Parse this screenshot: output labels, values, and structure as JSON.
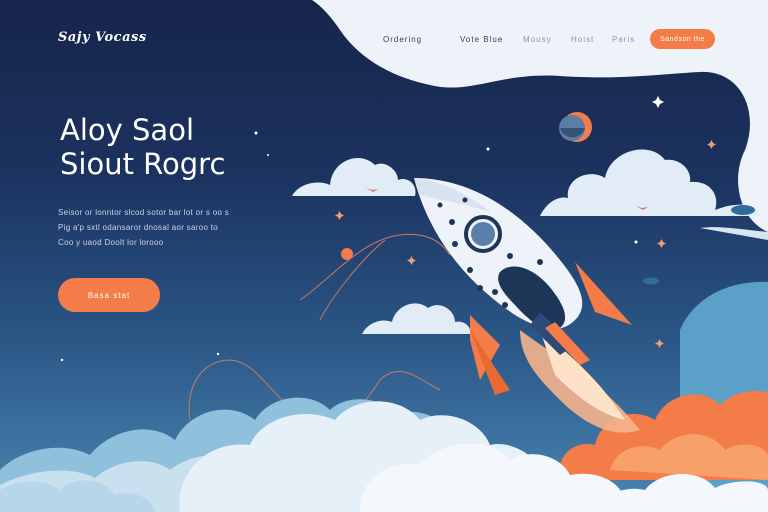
{
  "header": {
    "logo_text": "Sajy Vocass",
    "nav": [
      "Ordering",
      "Vote Blue",
      "Mousy",
      "Hoist",
      "Paris"
    ],
    "cta_label": "Sandson the"
  },
  "hero": {
    "title_lines": [
      "Aloy Saol",
      "Siout Rogrc"
    ],
    "body_lines": [
      "Seisor or lonntor slcod sotor bar lot or s oo s",
      "Pig a'p sxtl odansaror dnosal aor saroo to",
      "Coo y uaod Doolt lor lorooo"
    ],
    "cta_label": "Basa stat"
  },
  "colors": {
    "accent": "#f47c48",
    "navy": "#16254a",
    "sky_light": "#eef3f9"
  }
}
